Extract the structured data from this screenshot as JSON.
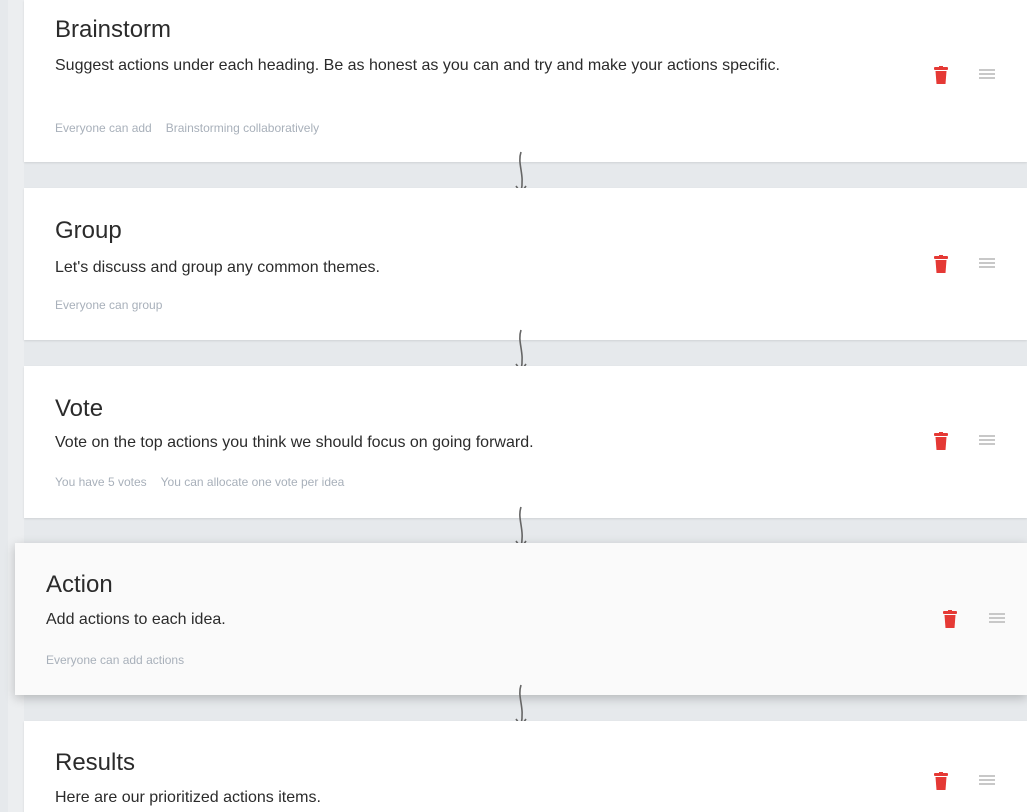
{
  "stages": [
    {
      "title": "Brainstorm",
      "description": "Suggest actions under each heading. Be as honest as you can and try and make your actions specific.",
      "meta": [
        "Everyone can add",
        "Brainstorming collaboratively"
      ]
    },
    {
      "title": "Group",
      "description": "Let's discuss and group any common themes.",
      "meta": [
        "Everyone can group"
      ]
    },
    {
      "title": "Vote",
      "description": "Vote on the top actions you think we should focus on going forward.",
      "meta": [
        "You have 5 votes",
        "You can allocate one vote per idea"
      ]
    },
    {
      "title": "Action",
      "description": "Add actions to each idea.",
      "meta": [
        "Everyone can add actions"
      ]
    },
    {
      "title": "Results",
      "description": "Here are our prioritized actions items.",
      "meta": []
    }
  ],
  "icons": {
    "delete": "trash-icon",
    "reorder": "drag-handle-icon",
    "connector": "arrow-down-icon"
  },
  "colors": {
    "delete": "#e53935",
    "handle": "#c8c8c8",
    "muted_text": "#a8b0ba",
    "arrow": "#666666"
  }
}
